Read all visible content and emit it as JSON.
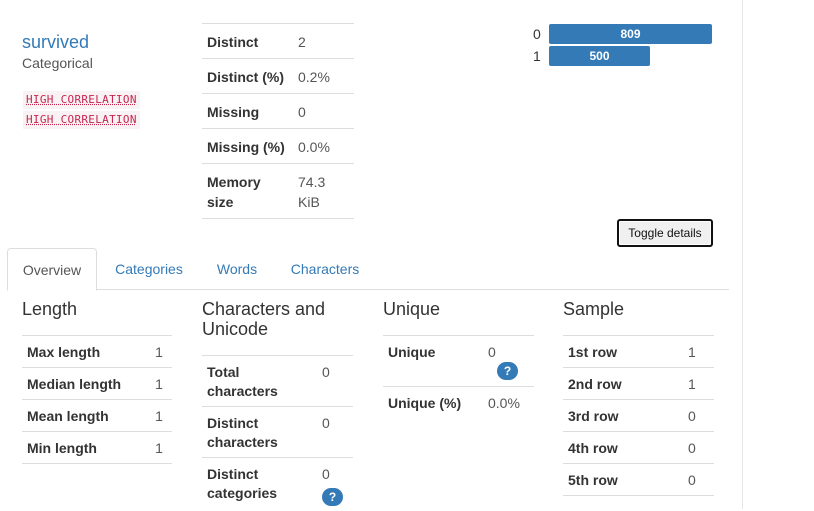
{
  "variable": {
    "name": "survived",
    "type": "Categorical",
    "alerts": [
      "HIGH CORRELATION",
      "HIGH CORRELATION"
    ]
  },
  "summary": [
    {
      "label": "Distinct",
      "value": "2"
    },
    {
      "label": "Distinct (%)",
      "value": "0.2%"
    },
    {
      "label": "Missing",
      "value": "0"
    },
    {
      "label": "Missing (%)",
      "value": "0.0%"
    },
    {
      "label": "Memory size",
      "value": "74.3 KiB"
    }
  ],
  "chart_data": {
    "type": "bar",
    "orientation": "horizontal",
    "categories": [
      "0",
      "1"
    ],
    "values": [
      809,
      500
    ],
    "xlim": [
      0,
      809
    ]
  },
  "toggle_label": "Toggle details",
  "tabs": [
    "Overview",
    "Categories",
    "Words",
    "Characters"
  ],
  "active_tab": "Overview",
  "sections": {
    "length": {
      "title": "Length",
      "rows": [
        {
          "label": "Max length",
          "value": "1"
        },
        {
          "label": "Median length",
          "value": "1"
        },
        {
          "label": "Mean length",
          "value": "1"
        },
        {
          "label": "Min length",
          "value": "1"
        }
      ]
    },
    "characters": {
      "title": "Characters and Unicode",
      "rows": [
        {
          "label": "Total characters",
          "value": "0"
        },
        {
          "label": "Distinct characters",
          "value": "0"
        },
        {
          "label": "Distinct categories",
          "value": "0"
        }
      ]
    },
    "unique": {
      "title": "Unique",
      "rows": [
        {
          "label": "Unique",
          "value": "0"
        },
        {
          "label": "Unique (%)",
          "value": "0.0%"
        }
      ]
    },
    "sample": {
      "title": "Sample",
      "rows": [
        {
          "label": "1st row",
          "value": "1"
        },
        {
          "label": "2nd row",
          "value": "1"
        },
        {
          "label": "3rd row",
          "value": "0"
        },
        {
          "label": "4th row",
          "value": "0"
        },
        {
          "label": "5th row",
          "value": "0"
        }
      ]
    }
  },
  "help_glyph": "?",
  "colors": {
    "accent": "#337ab7",
    "alert_text": "#c7254e",
    "alert_bg": "#f9f2f4"
  }
}
